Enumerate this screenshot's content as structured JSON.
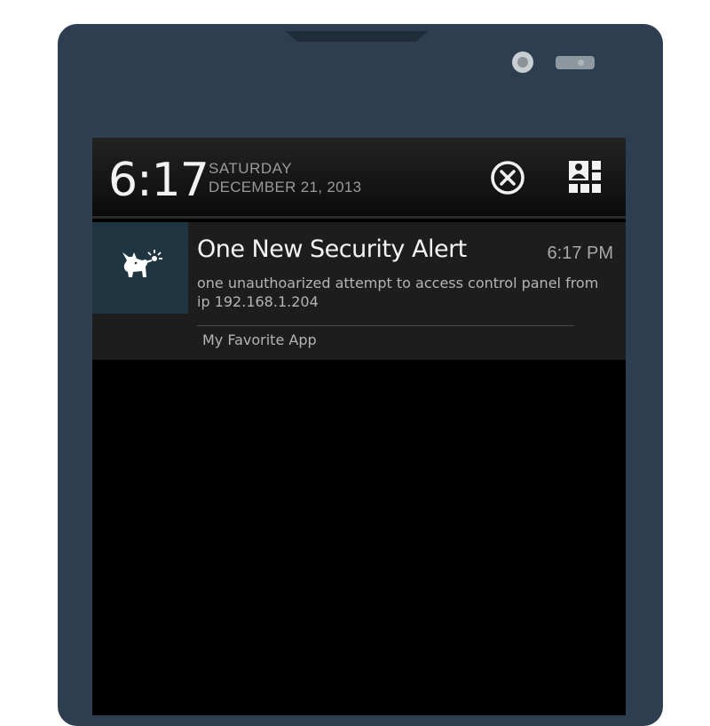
{
  "status_bar": {
    "time": "6:17",
    "day": "SATURDAY",
    "date": "DECEMBER 21, 2013"
  },
  "icons": {
    "dismiss": "close-circle-icon",
    "settings": "quick-settings-icon",
    "app": "dog-app-icon"
  },
  "notification": {
    "title": "One New Security Alert",
    "time": "6:17 PM",
    "body": "one unauthoarized attempt to access control panel from ip 192.168.1.204",
    "app_name": "My Favorite App"
  },
  "colors": {
    "device": "#2c3e50",
    "app_icon_bg": "#1f3642",
    "notification_bg": "#1d1d1d",
    "screen_bg": "#000000"
  }
}
